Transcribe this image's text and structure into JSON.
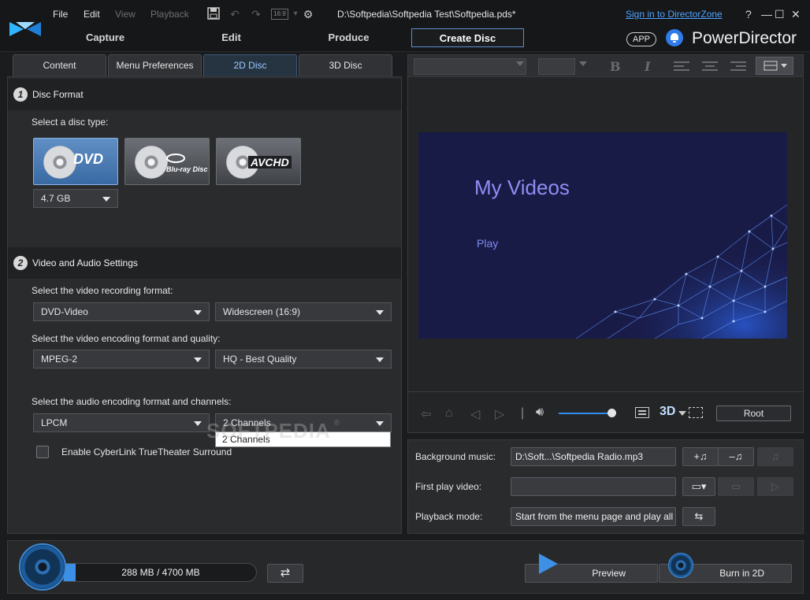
{
  "titlebar": {
    "menus": [
      "File",
      "Edit",
      "View",
      "Playback"
    ],
    "file_path": "D:\\Softpedia\\Softpedia Test\\Softpedia.pds*",
    "signin_link": "Sign in to DirectorZone",
    "help": "?",
    "aspect_ratio": "16:9",
    "mode_tabs": [
      "Capture",
      "Edit",
      "Produce",
      "Create Disc"
    ],
    "active_mode": "Create Disc",
    "app_badge": "APP",
    "app_name": "PowerDirector"
  },
  "subtabs": [
    "Content",
    "Menu Preferences",
    "2D Disc",
    "3D Disc"
  ],
  "active_subtab": "2D Disc",
  "disc_format": {
    "step": "1",
    "title": "Disc Format",
    "select_label": "Select a disc type:",
    "disc_types": [
      {
        "name": "dvd-icon",
        "logo": "DVD"
      },
      {
        "name": "bluray-icon",
        "logo": "Blu-ray Disc"
      },
      {
        "name": "avchd-icon",
        "logo": "AVCHD"
      }
    ],
    "selected_disc": "DVD",
    "capacity_value": "4.7 GB"
  },
  "video_audio": {
    "step": "2",
    "title": "Video and Audio Settings",
    "recording_label": "Select the video recording format:",
    "recording_format": "DVD-Video",
    "aspect": "Widescreen (16:9)",
    "encoding_label": "Select the video encoding format and quality:",
    "encoding_format": "MPEG-2",
    "quality": "HQ - Best Quality",
    "audio_label": "Select the audio encoding format and channels:",
    "audio_format": "LPCM",
    "channels": "2 Channels",
    "channels_dropdown_option": "2 Channels",
    "surround_label": "Enable CyberLink TrueTheater Surround",
    "surround_checked": false
  },
  "watermark": "SOFTPEDIA",
  "watermark_reg": "®",
  "preview": {
    "menu_title": "My Videos",
    "menu_play": "Play",
    "root_button": "Root",
    "volume_level": 0.9,
    "threed_label": "3D"
  },
  "settings": {
    "bg_music_label": "Background music:",
    "bg_music_value": "D:\\Soft...\\Softpedia Radio.mp3",
    "first_play_label": "First play video:",
    "first_play_value": "",
    "playback_label": "Playback mode:",
    "playback_value": "Start from the menu page and play all t"
  },
  "bottom": {
    "capacity_text": "288 MB / 4700 MB",
    "capacity_used_mb": 288,
    "capacity_total_mb": 4700,
    "preview_label": "Preview",
    "burn_label": "Burn in 2D"
  },
  "colors": {
    "accent": "#3b8fe4",
    "link": "#4fa3ff",
    "menu_bg": "#191b47",
    "menu_title": "#8f8df2"
  }
}
